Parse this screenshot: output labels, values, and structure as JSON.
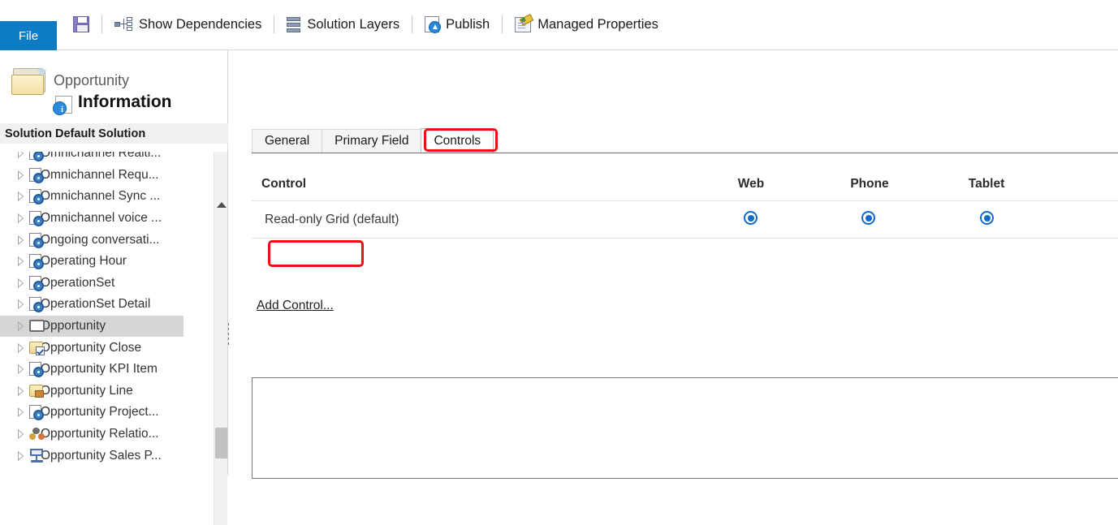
{
  "ribbon": {
    "file_label": "File",
    "commands": [
      {
        "icon": "save-icon",
        "label": ""
      },
      {
        "icon": "show-dependencies-icon",
        "label": "Show Dependencies"
      },
      {
        "icon": "solution-layers-icon",
        "label": "Solution Layers"
      },
      {
        "icon": "publish-icon",
        "label": "Publish"
      },
      {
        "icon": "managed-properties-icon",
        "label": "Managed Properties"
      }
    ]
  },
  "sidebar": {
    "entity_name": "Opportunity",
    "page_title": "Information",
    "solution_bar": "Solution Default Solution",
    "folder_icon": "solution-folder-icon",
    "info_icon": "information-page-icon",
    "items": [
      {
        "label": "Omnichannel Realti...",
        "icon": "entity-doc-gear-icon",
        "selected": false
      },
      {
        "label": "Omnichannel Requ...",
        "icon": "entity-doc-gear-icon",
        "selected": false
      },
      {
        "label": "Omnichannel Sync ...",
        "icon": "entity-doc-gear-icon",
        "selected": false
      },
      {
        "label": "Omnichannel voice ...",
        "icon": "entity-doc-gear-icon",
        "selected": false
      },
      {
        "label": "Ongoing conversati...",
        "icon": "entity-doc-gear-icon",
        "selected": false
      },
      {
        "label": "Operating Hour",
        "icon": "entity-doc-gear-icon",
        "selected": false
      },
      {
        "label": "OperationSet",
        "icon": "entity-doc-gear-icon",
        "selected": false
      },
      {
        "label": "OperationSet Detail",
        "icon": "entity-doc-gear-icon",
        "selected": false
      },
      {
        "label": "Opportunity",
        "icon": "entity-frame-icon",
        "selected": true
      },
      {
        "label": "Opportunity Close",
        "icon": "entity-folder-check-icon",
        "selected": false
      },
      {
        "label": "Opportunity KPI Item",
        "icon": "entity-doc-gear-icon",
        "selected": false
      },
      {
        "label": "Opportunity Line",
        "icon": "entity-folder-box-icon",
        "selected": false
      },
      {
        "label": "Opportunity Project...",
        "icon": "entity-doc-gear-icon",
        "selected": false
      },
      {
        "label": "Opportunity Relatio...",
        "icon": "entity-people-icon",
        "selected": false
      },
      {
        "label": "Opportunity Sales P...",
        "icon": "entity-process-icon",
        "selected": false
      }
    ],
    "scrollbar": {
      "up_arrow_icon": "scroll-up-arrow-icon"
    }
  },
  "main": {
    "tabs": [
      {
        "label": "General",
        "active": false
      },
      {
        "label": "Primary Field",
        "active": false
      },
      {
        "label": "Controls",
        "active": true
      }
    ],
    "grid": {
      "columns": [
        "Control",
        "Web",
        "Phone",
        "Tablet"
      ],
      "rows": [
        {
          "name": "Read-only Grid (default)",
          "web": true,
          "phone": true,
          "tablet": true
        }
      ]
    },
    "add_control_label": "Add Control..."
  },
  "annotations": {
    "highlight_color": "#e81212",
    "targets": [
      "Controls",
      "Add Control..."
    ]
  },
  "colors": {
    "file_tab_blue": "#0d7cc4",
    "radio_blue": "#1569c7",
    "selection_gray": "#d6d6d6",
    "highlight_red": "#e81212"
  }
}
